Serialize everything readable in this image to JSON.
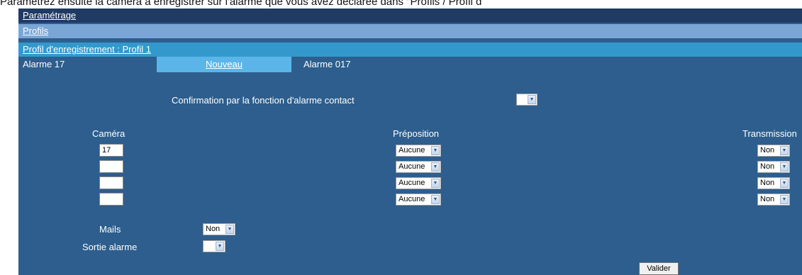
{
  "doc_text": "Paramétrez ensuite la caméra à enregistrer sur l'alarme que vous avez déclarée dans \"Profils / Profil d",
  "nav": {
    "parametrage": "Paramétrage",
    "profils": "Profils",
    "profil_enregistrement": "Profil d'enregistrement : Profil 1"
  },
  "alarm": {
    "title": "Alarme 17",
    "new_tab": "Nouveau",
    "name": "Alarme 017"
  },
  "confirmation": {
    "label": "Confirmation par la fonction d'alarme contact",
    "value": ""
  },
  "table": {
    "camera_header": "Caméra",
    "preposition_header": "Préposition",
    "transmission_header": "Transmission",
    "rows": [
      {
        "camera": "17",
        "preposition": "Aucune",
        "transmission": "Non"
      },
      {
        "camera": "",
        "preposition": "Aucune",
        "transmission": "Non"
      },
      {
        "camera": "",
        "preposition": "Aucune",
        "transmission": "Non"
      },
      {
        "camera": "",
        "preposition": "Aucune",
        "transmission": "Non"
      }
    ]
  },
  "mails": {
    "label": "Mails",
    "value": "Non"
  },
  "sortie": {
    "label": "Sortie alarme",
    "value": ""
  },
  "valider": "Valider",
  "icons": {
    "dropdown": "chevron-down-icon"
  }
}
